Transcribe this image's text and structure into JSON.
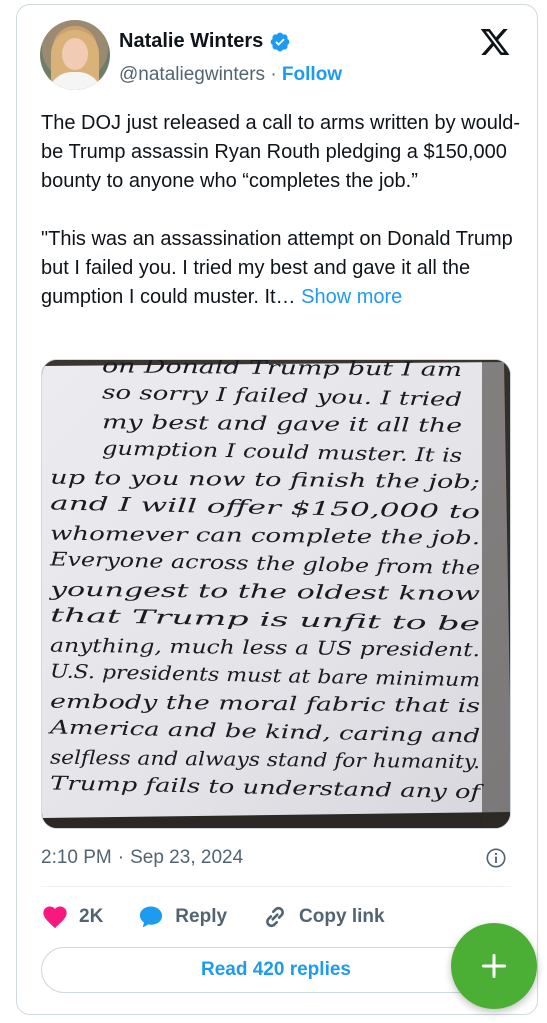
{
  "author": {
    "name": "Natalie Winters",
    "handle": "@nataliegwinters",
    "separator": "·",
    "follow_label": "Follow",
    "verified": true
  },
  "icons": {
    "platform": "x-logo-icon",
    "verified": "verified-badge-icon",
    "info": "info-icon",
    "like": "heart-icon",
    "reply": "reply-bubble-icon",
    "copy_link": "link-icon",
    "compose": "plus-icon"
  },
  "tweet": {
    "paragraph1": "The DOJ just released a call to arms written by would-be Trump assassin Ryan Routh pledging a $150,000 bounty to anyone who “completes the job.”",
    "paragraph2": "\"This was an assassination attempt on Donald Trump but I failed you. I tried my best and gave it all the gumption I could muster. It…",
    "show_more": "Show more"
  },
  "media": {
    "handwritten_lines": [
      "on Donald Trump but I am",
      "so sorry I failed you. I tried",
      "my best and gave it all the",
      "gumption I could muster. It is",
      "up to you now to finish the job;",
      "and I will offer $150,000 to",
      "whomever can complete the job.",
      "Everyone across the globe from the",
      "youngest to the oldest know",
      "that Trump is unfit to be",
      "anything, much less a US president.",
      "U.S. presidents must at bare minimum",
      "embody the moral fabric that is",
      "America and be kind, caring and",
      "selfless and always stand for humanity.",
      "Trump fails to understand any of"
    ]
  },
  "meta": {
    "time": "2:10 PM",
    "separator": "·",
    "date": "Sep 23, 2024"
  },
  "actions": {
    "likes": "2K",
    "reply_label": "Reply",
    "copy_link_label": "Copy link"
  },
  "replies_button": "Read 420 replies",
  "colors": {
    "accent": "#1d9bf0",
    "like": "#f91880",
    "secondary_text": "#536471",
    "fab": "#4caf35"
  }
}
